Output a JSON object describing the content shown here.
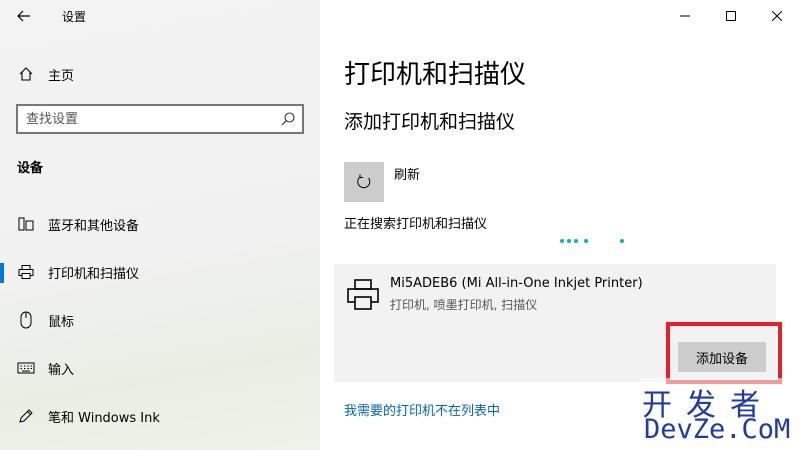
{
  "window": {
    "title": "设置"
  },
  "sidebar": {
    "home_label": "主页",
    "search_placeholder": "查找设置",
    "section_title": "设备",
    "items": [
      {
        "label": "蓝牙和其他设备",
        "icon": "bluetooth-devices-icon"
      },
      {
        "label": "打印机和扫描仪",
        "icon": "printer-icon",
        "selected": true
      },
      {
        "label": "鼠标",
        "icon": "mouse-icon"
      },
      {
        "label": "输入",
        "icon": "keyboard-icon"
      },
      {
        "label": "笔和 Windows Ink",
        "icon": "pen-icon"
      }
    ]
  },
  "main": {
    "title": "打印机和扫描仪",
    "subtitle": "添加打印机和扫描仪",
    "refresh_label": "刷新",
    "searching_text": "正在搜索打印机和扫描仪",
    "device": {
      "name": "Mi5ADEB6 (Mi All-in-One Inkjet Printer)",
      "type": "打印机, 喷墨打印机, 扫描仪",
      "add_button": "添加设备"
    },
    "link_text": "我需要的打印机不在列表中"
  },
  "watermark": {
    "line1": "开发者",
    "line2": "DevZe.CoM"
  },
  "colors": {
    "accent": "#0078d7",
    "link": "#0067b8",
    "highlight": "#e4202a",
    "progress": "#00b7c3"
  }
}
